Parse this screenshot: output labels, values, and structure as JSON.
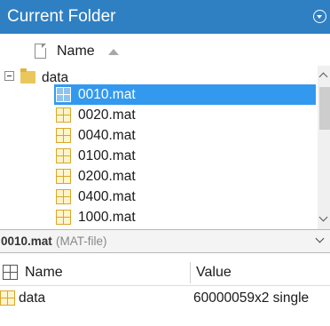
{
  "panel": {
    "title": "Current Folder",
    "menu_icon": "circle-chevron-down-icon"
  },
  "file_list": {
    "column_name": "Name",
    "sort_icon": "sort-ascending-icon",
    "folder": {
      "name": "data",
      "expanded": true
    },
    "files": [
      {
        "name": "0010.mat",
        "selected": true
      },
      {
        "name": "0020.mat",
        "selected": false
      },
      {
        "name": "0040.mat",
        "selected": false
      },
      {
        "name": "0100.mat",
        "selected": false
      },
      {
        "name": "0200.mat",
        "selected": false
      },
      {
        "name": "0400.mat",
        "selected": false
      },
      {
        "name": "1000.mat",
        "selected": false
      }
    ]
  },
  "details": {
    "file_name": "0010.mat",
    "file_type": "(MAT-file)"
  },
  "variables": {
    "column_name": "Name",
    "column_value": "Value",
    "rows": [
      {
        "name": "data",
        "value": "60000059x2 single"
      }
    ]
  },
  "colors": {
    "title_bar": "#2f7fc3",
    "selection": "#3399ee",
    "mat_icon": "#d9a62a"
  }
}
